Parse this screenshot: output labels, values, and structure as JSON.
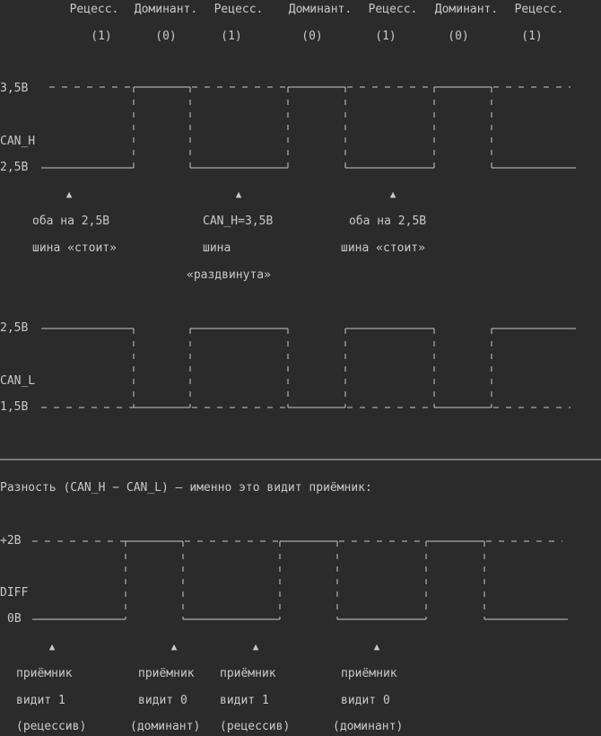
{
  "header": {
    "states": [
      {
        "name": "Рецесс.",
        "bit": "(1)"
      },
      {
        "name": "Доминант.",
        "bit": "(0)"
      },
      {
        "name": "Рецесс.",
        "bit": "(1)"
      },
      {
        "name": "Доминант.",
        "bit": "(0)"
      },
      {
        "name": "Рецесс.",
        "bit": "(1)"
      },
      {
        "name": "Доминант.",
        "bit": "(0)"
      },
      {
        "name": "Рецесс.",
        "bit": "(1)"
      }
    ]
  },
  "can_h": {
    "signal_label": "CAN_H",
    "level_high_label": "3,5В",
    "level_low_label": "2,5В",
    "annotations": [
      {
        "lines": [
          "оба на 2,5В",
          "шина «стоит»"
        ]
      },
      {
        "lines": [
          "CAN_H=3,5В",
          "шина",
          "«раздвинута»"
        ]
      },
      {
        "lines": [
          "оба на 2,5В",
          "шина «стоит»"
        ]
      }
    ]
  },
  "can_l": {
    "signal_label": "CAN_L",
    "level_high_label": "2,5В",
    "level_low_label": "1,5В"
  },
  "diff": {
    "caption": "Разность (CAN_H − CAN_L) — именно это видит приёмник:",
    "signal_label": "DIFF",
    "level_high_label": "+2В",
    "level_low_label": "0В",
    "annotations": [
      {
        "lines": [
          "приёмник",
          "видит 1",
          "(рецессив)"
        ]
      },
      {
        "lines": [
          "приёмник",
          "видит 0",
          "(доминант)"
        ]
      },
      {
        "lines": [
          "приёмник",
          "видит 1",
          "(рецессив)"
        ]
      },
      {
        "lines": [
          "приёмник",
          "видит 0",
          "(доминант)"
        ]
      }
    ]
  },
  "colors": {
    "background": "#2b2b2b",
    "text": "#c9c9c9"
  }
}
